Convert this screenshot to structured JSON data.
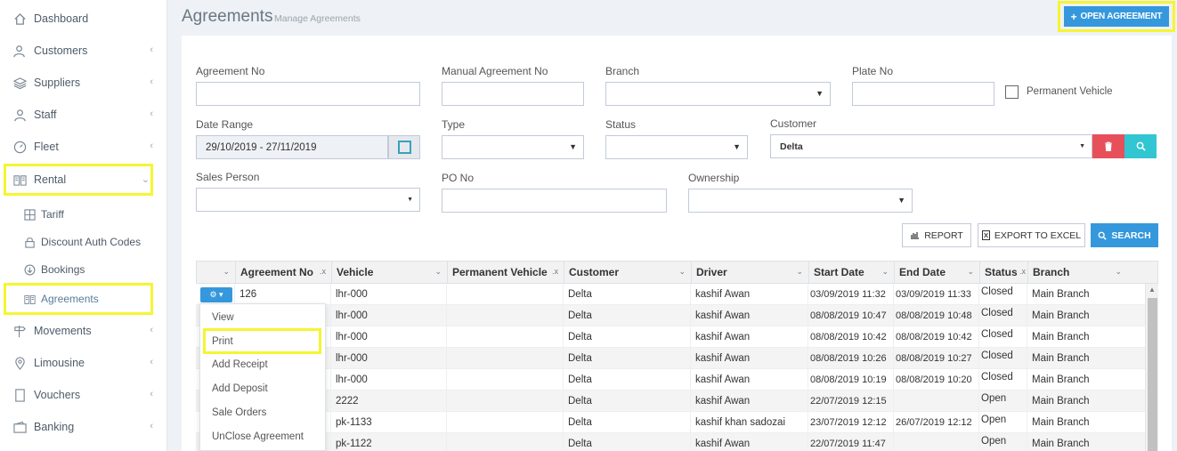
{
  "sidebar": {
    "items": [
      {
        "label": "Dashboard",
        "icon": "home-icon"
      },
      {
        "label": "Customers",
        "icon": "users-icon"
      },
      {
        "label": "Suppliers",
        "icon": "layers-icon"
      },
      {
        "label": "Staff",
        "icon": "user-icon"
      },
      {
        "label": "Fleet",
        "icon": "speedometer-icon"
      },
      {
        "label": "Rental",
        "icon": "book-icon"
      },
      {
        "label": "Movements",
        "icon": "signpost-icon"
      },
      {
        "label": "Limousine",
        "icon": "map-pin-icon"
      },
      {
        "label": "Vouchers",
        "icon": "doc-icon"
      },
      {
        "label": "Banking",
        "icon": "wallet-icon"
      }
    ],
    "rental_sub": [
      {
        "label": "Tariff",
        "icon": "grid-icon"
      },
      {
        "label": "Discount Auth Codes",
        "icon": "lock-icon"
      },
      {
        "label": "Bookings",
        "icon": "arrow-circle-icon"
      },
      {
        "label": "Agreements",
        "icon": "book-icon"
      }
    ]
  },
  "header": {
    "title": "Agreements",
    "subtitle": "Manage Agreements",
    "open_button": "OPEN AGREEMENT"
  },
  "filters": {
    "agreement_no": {
      "label": "Agreement No",
      "value": ""
    },
    "manual_agreement_no": {
      "label": "Manual Agreement No",
      "value": ""
    },
    "branch": {
      "label": "Branch",
      "value": ""
    },
    "plate_no": {
      "label": "Plate No",
      "value": ""
    },
    "permanent_vehicle": {
      "label": "Permanent Vehicle",
      "checked": false
    },
    "date_range": {
      "label": "Date Range",
      "value": "29/10/2019 - 27/11/2019"
    },
    "type": {
      "label": "Type",
      "value": ""
    },
    "status": {
      "label": "Status",
      "value": ""
    },
    "customer": {
      "label": "Customer",
      "value": "Delta"
    },
    "sales_person": {
      "label": "Sales Person",
      "value": ""
    },
    "po_no": {
      "label": "PO No",
      "value": ""
    },
    "ownership": {
      "label": "Ownership",
      "value": ""
    }
  },
  "actions": {
    "report": "REPORT",
    "export": "EXPORT TO EXCEL",
    "search": "SEARCH"
  },
  "table": {
    "columns": [
      "Agreement No",
      "Vehicle",
      "Permanent Vehicle",
      "Customer",
      "Driver",
      "Start Date",
      "End Date",
      "Status",
      "Branch"
    ],
    "rows": [
      {
        "agreement_no": "126",
        "vehicle": "lhr-000",
        "permanent_vehicle": "",
        "customer": "Delta",
        "driver": "kashif Awan",
        "start": "03/09/2019 11:32",
        "end": "03/09/2019 11:33",
        "status": "Closed",
        "branch": "Main Branch"
      },
      {
        "agreement_no": "",
        "vehicle": "lhr-000",
        "permanent_vehicle": "",
        "customer": "Delta",
        "driver": "kashif Awan",
        "start": "08/08/2019 10:47",
        "end": "08/08/2019 10:48",
        "status": "Closed",
        "branch": "Main Branch"
      },
      {
        "agreement_no": "",
        "vehicle": "lhr-000",
        "permanent_vehicle": "",
        "customer": "Delta",
        "driver": "kashif Awan",
        "start": "08/08/2019 10:42",
        "end": "08/08/2019 10:42",
        "status": "Closed",
        "branch": "Main Branch"
      },
      {
        "agreement_no": "",
        "vehicle": "lhr-000",
        "permanent_vehicle": "",
        "customer": "Delta",
        "driver": "kashif Awan",
        "start": "08/08/2019 10:26",
        "end": "08/08/2019 10:27",
        "status": "Closed",
        "branch": "Main Branch"
      },
      {
        "agreement_no": "",
        "vehicle": "lhr-000",
        "permanent_vehicle": "",
        "customer": "Delta",
        "driver": "kashif Awan",
        "start": "08/08/2019 10:19",
        "end": "08/08/2019 10:20",
        "status": "Closed",
        "branch": "Main Branch"
      },
      {
        "agreement_no": "",
        "vehicle": "2222",
        "permanent_vehicle": "",
        "customer": "Delta",
        "driver": "kashif Awan",
        "start": "22/07/2019 12:15",
        "end": "",
        "status": "Open",
        "branch": "Main Branch"
      },
      {
        "agreement_no": "",
        "vehicle": "pk-1133",
        "permanent_vehicle": "",
        "customer": "Delta",
        "driver": "kashif khan sadozai",
        "start": "23/07/2019 12:12",
        "end": "26/07/2019 12:12",
        "status": "Open",
        "branch": "Main Branch"
      },
      {
        "agreement_no": "",
        "vehicle": "pk-1122",
        "permanent_vehicle": "",
        "customer": "Delta",
        "driver": "kashif Awan",
        "start": "22/07/2019 11:47",
        "end": "",
        "status": "Open",
        "branch": "Main Branch"
      }
    ]
  },
  "row_menu": {
    "items": [
      "View",
      "Print",
      "Add Receipt",
      "Add Deposit",
      "Sale Orders",
      "UnClose Agreement"
    ]
  },
  "colors": {
    "accent": "#3598dc",
    "danger": "#e7505a",
    "teal": "#32c5d2",
    "highlight": "#f5f532"
  }
}
